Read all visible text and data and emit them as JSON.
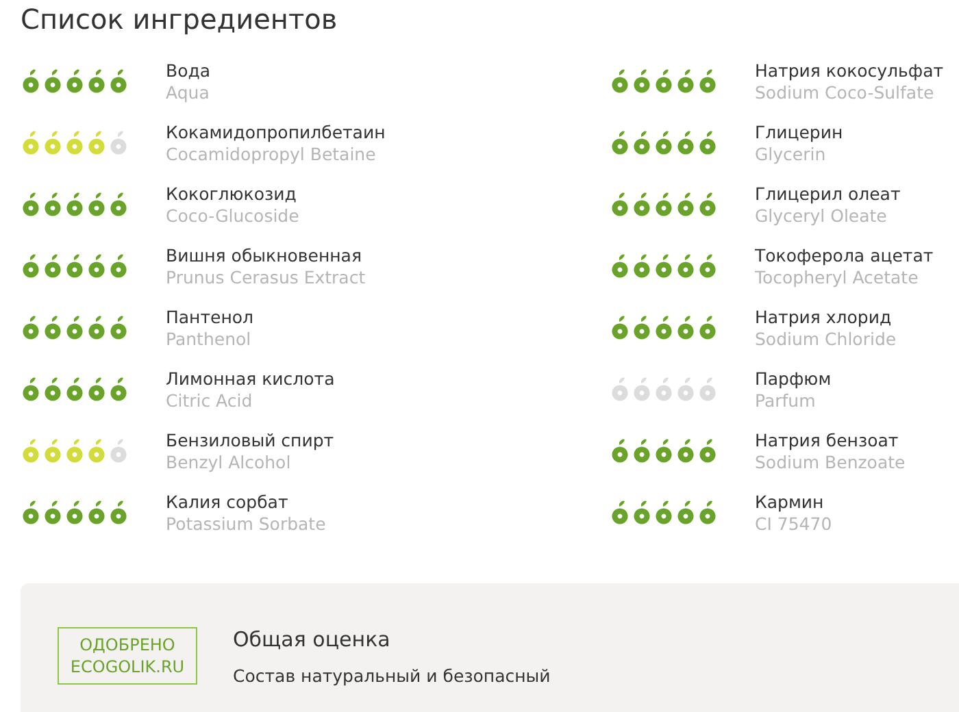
{
  "title": "Список ингредиентов",
  "ingredients": [
    {
      "name": "Вода",
      "latin": "Aqua",
      "stars": 5
    },
    {
      "name": "Натрия кокосульфат",
      "latin": "Sodium Coco-Sulfate",
      "stars": 5
    },
    {
      "name": "Кокамидопропилбетаин",
      "latin": "Cocamidopropyl Betaine",
      "stars": 4
    },
    {
      "name": "Глицерин",
      "latin": "Glycerin",
      "stars": 5
    },
    {
      "name": "Кокоглюкозид",
      "latin": "Coco-Glucoside",
      "stars": 5
    },
    {
      "name": "Глицерил олеат",
      "latin": "Glyceryl Oleate",
      "stars": 5
    },
    {
      "name": "Вишня обыкновенная",
      "latin": "Prunus Cerasus Extract",
      "stars": 5
    },
    {
      "name": "Токоферола ацетат",
      "latin": "Tocopheryl Acetate",
      "stars": 5
    },
    {
      "name": "Пантенол",
      "latin": "Panthenol",
      "stars": 5
    },
    {
      "name": "Натрия хлорид",
      "latin": "Sodium Chloride",
      "stars": 5
    },
    {
      "name": "Лимонная кислота",
      "latin": "Citric Acid",
      "stars": 5
    },
    {
      "name": "Парфюм",
      "latin": "Parfum",
      "stars": 0
    },
    {
      "name": "Бензиловый спирт",
      "latin": "Benzyl Alcohol",
      "stars": 4
    },
    {
      "name": "Натрия бензоат",
      "latin": "Sodium Benzoate",
      "stars": 5
    },
    {
      "name": "Калия сорбат",
      "latin": "Potassium Sorbate",
      "stars": 5
    },
    {
      "name": "Кармин",
      "latin": "CI 75470",
      "stars": 5
    }
  ],
  "summary": {
    "badge_top": "ОДОБРЕНО",
    "badge_bottom": "ECOGOLIK.RU",
    "heading": "Общая оценка",
    "text": "Состав натуральный и безопасный"
  }
}
